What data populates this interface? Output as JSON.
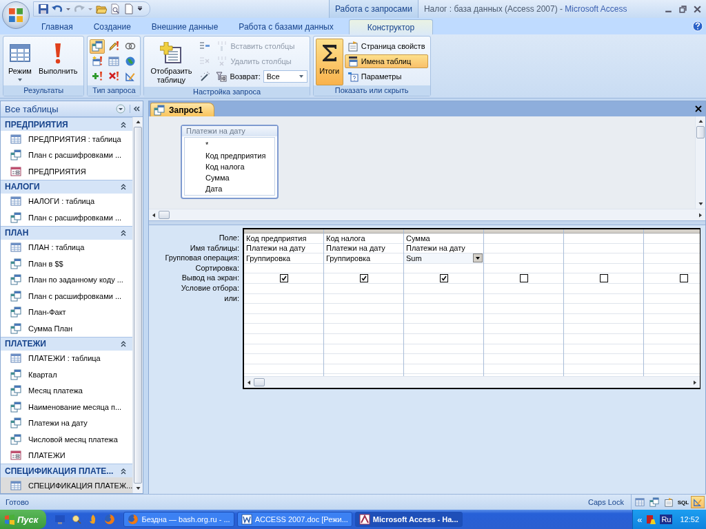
{
  "title_bar": {
    "context_label": "Работа с запросами",
    "document": "Налог : база данных (Access 2007)",
    "separator": "-",
    "app": "Microsoft Access"
  },
  "tabs": [
    {
      "label": "Главная",
      "selected": false
    },
    {
      "label": "Создание",
      "selected": false
    },
    {
      "label": "Внешние данные",
      "selected": false
    },
    {
      "label": "Работа с базами данных",
      "selected": false
    },
    {
      "label": "Конструктор",
      "selected": true
    }
  ],
  "ribbon_groups": [
    {
      "title": "Результаты",
      "items": [
        {
          "kind": "split",
          "label": "Режим"
        },
        {
          "kind": "large",
          "label": "Выполнить"
        }
      ]
    },
    {
      "title": "Тип запроса",
      "items": [
        {
          "kind": "icon",
          "selected": true
        },
        {
          "kind": "icon",
          "selected": false
        },
        {
          "kind": "icon",
          "selected": false
        },
        {
          "kind": "icon",
          "selected": false
        },
        {
          "kind": "icon",
          "selected": false
        },
        {
          "kind": "icon",
          "selected": false
        },
        {
          "kind": "icon",
          "selected": false
        },
        {
          "kind": "icon",
          "selected": false
        },
        {
          "kind": "icon",
          "selected": false
        }
      ]
    },
    {
      "title": "Настройка запроса",
      "items": [
        {
          "kind": "large",
          "label": "Отобразить таблицу"
        },
        {
          "kind": "icon",
          "disabled": false
        },
        {
          "kind": "icon",
          "disabled": true
        },
        {
          "kind": "icon",
          "disabled": false
        },
        {
          "kind": "small",
          "label": "Вставить столбцы",
          "disabled": true
        },
        {
          "kind": "small",
          "label": "Удалить столбцы",
          "disabled": true
        },
        {
          "kind": "combo",
          "label": "Возврат:",
          "value": "Все"
        }
      ]
    },
    {
      "title": "Показать или скрыть",
      "items": [
        {
          "kind": "large",
          "label": "Итоги",
          "selected": true
        },
        {
          "kind": "small",
          "label": "Страница свойств",
          "selected": false
        },
        {
          "kind": "small",
          "label": "Имена таблиц",
          "selected": true
        },
        {
          "kind": "small",
          "label": "Параметры",
          "selected": false
        }
      ]
    }
  ],
  "navigation": {
    "title": "Все таблицы",
    "groups": [
      {
        "title": "ПРЕДПРИЯТИЯ",
        "items": [
          {
            "kind": "table",
            "label": "ПРЕДПРИЯТИЯ : таблица",
            "selected": false
          },
          {
            "kind": "query",
            "label": "План с расшифровками ...",
            "selected": false
          },
          {
            "kind": "form",
            "label": "ПРЕДПРИЯТИЯ",
            "selected": false
          }
        ]
      },
      {
        "title": "НАЛОГИ",
        "items": [
          {
            "kind": "table",
            "label": "НАЛОГИ : таблица",
            "selected": false
          },
          {
            "kind": "query",
            "label": "План с расшифровками ...",
            "selected": false
          }
        ]
      },
      {
        "title": "ПЛАН",
        "items": [
          {
            "kind": "table",
            "label": "ПЛАН : таблица",
            "selected": false
          },
          {
            "kind": "query",
            "label": "План в $$",
            "selected": false
          },
          {
            "kind": "query",
            "label": "План по заданному коду ...",
            "selected": false
          },
          {
            "kind": "query",
            "label": "План с расшифровками ...",
            "selected": false
          },
          {
            "kind": "query",
            "label": "План-Факт",
            "selected": false
          },
          {
            "kind": "query",
            "label": "Сумма План",
            "selected": false
          }
        ]
      },
      {
        "title": "ПЛАТЕЖИ",
        "items": [
          {
            "kind": "table",
            "label": "ПЛАТЕЖИ : таблица",
            "selected": false
          },
          {
            "kind": "query",
            "label": "Квартал",
            "selected": false
          },
          {
            "kind": "query",
            "label": "Месяц платежа",
            "selected": false
          },
          {
            "kind": "query",
            "label": "Наименование месяца п...",
            "selected": false
          },
          {
            "kind": "query",
            "label": "Платежи на дату",
            "selected": false
          },
          {
            "kind": "query",
            "label": "Числовой месяц платежа",
            "selected": false
          },
          {
            "kind": "form",
            "label": "ПЛАТЕЖИ",
            "selected": false
          }
        ]
      },
      {
        "title": "СПЕЦИФИКАЦИЯ ПЛАТЕ...",
        "items": [
          {
            "kind": "table",
            "label": "СПЕЦИФИКАЦИЯ ПЛАТЕЖ...",
            "selected": true
          }
        ]
      }
    ]
  },
  "document_tab": {
    "label": "Запрос1",
    "selected": true
  },
  "table_box": {
    "title": "Платежи на дату",
    "fields": [
      "*",
      "Код предприятия",
      "Код налога",
      "Сумма",
      "Дата"
    ]
  },
  "grid": {
    "row_labels": [
      "Поле:",
      "Имя таблицы:",
      "Групповая операция:",
      "Сортировка:",
      "Вывод на экран:",
      "Условие отбора:",
      "или:"
    ],
    "columns": [
      {
        "field": "Код предприятия",
        "table": "Платежи на дату",
        "total": "Группировка",
        "show": true,
        "focused": false
      },
      {
        "field": "Код налога",
        "table": "Платежи на дату",
        "total": "Группировка",
        "show": true,
        "focused": false
      },
      {
        "field": "Сумма",
        "table": "Платежи на дату",
        "total": "Sum",
        "show": true,
        "focused": true
      },
      {
        "show": false,
        "focused": false
      },
      {
        "show": false,
        "focused": false
      },
      {
        "show": false,
        "focused": false
      }
    ]
  },
  "status_bar": {
    "text": "Готово",
    "caps_lock": "Caps Lock",
    "views": [
      {
        "kind": "icon",
        "selected": false
      },
      {
        "kind": "icon",
        "selected": false
      },
      {
        "kind": "icon",
        "selected": false
      },
      {
        "kind": "text",
        "label": "SQL",
        "selected": false
      },
      {
        "kind": "icon",
        "selected": true
      }
    ]
  },
  "taskbar": {
    "start": "Пуск",
    "tasks": [
      {
        "label": "Бездна — bash.org.ru - ...",
        "selected": false
      },
      {
        "label": "ACCESS 2007.doc [Режи...",
        "selected": false
      },
      {
        "label": "Microsoft Access - На...",
        "selected": true
      }
    ],
    "tray": {
      "collapse": "«",
      "language": "Ru",
      "clock": "12:52"
    }
  }
}
